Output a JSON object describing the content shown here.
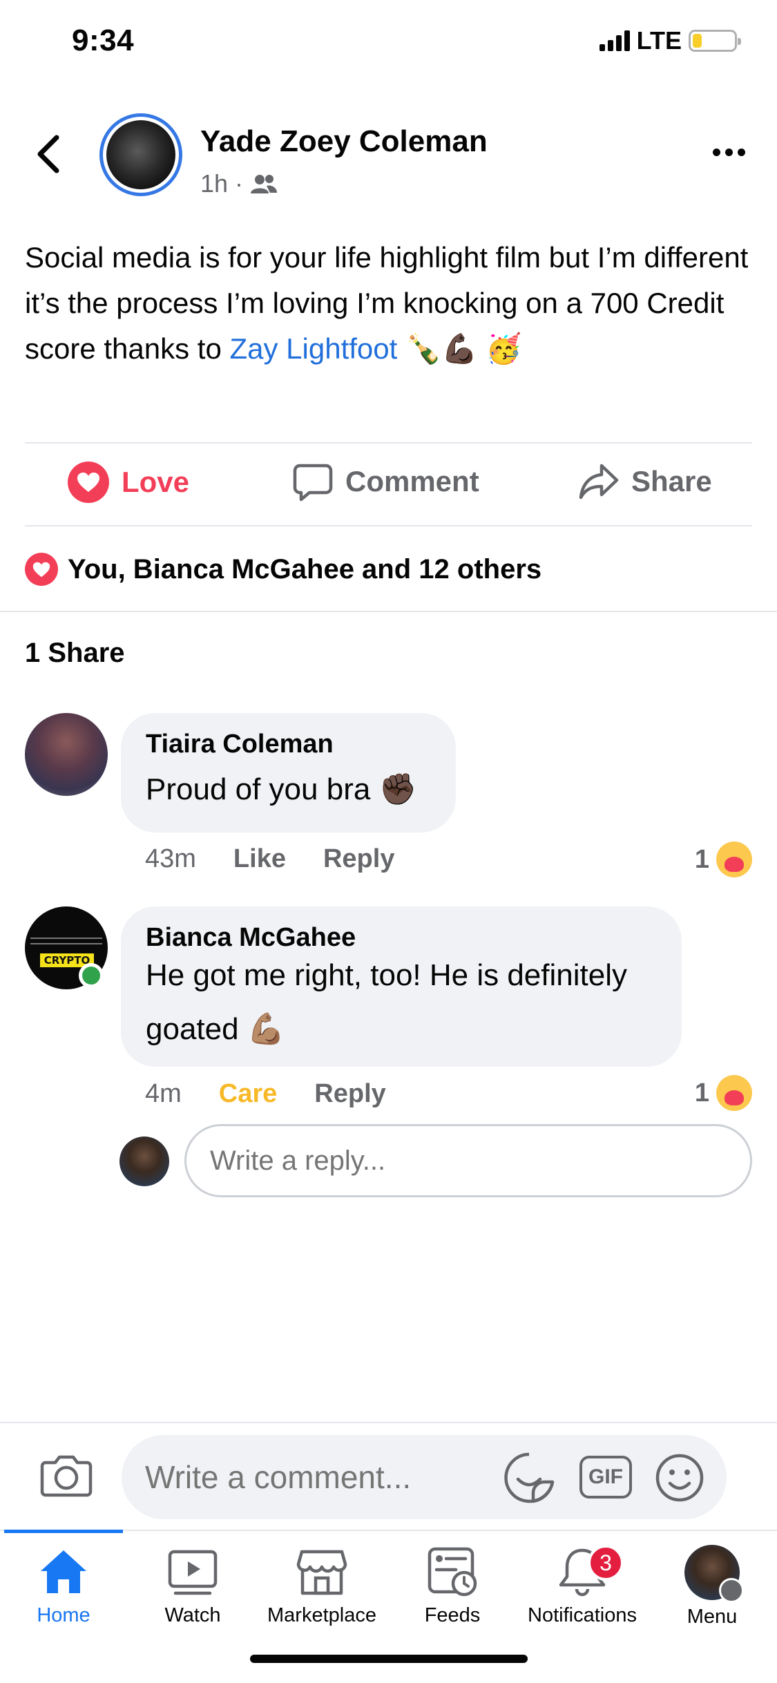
{
  "status_bar": {
    "time": "9:34",
    "network": "LTE",
    "battery_level": 0.22
  },
  "post": {
    "author": "Yade Zoey Coleman",
    "time": "1h",
    "privacy_icon": "friends-icon",
    "text_before": "Social media is for your life highlight film but I’m different it’s the process I’m loving I’m knocking on a 700 Credit score thanks to ",
    "mention": "Zay Lightfoot",
    "emojis": "🍾💪🏿 🥳",
    "actions": {
      "love": "Love",
      "comment": "Comment",
      "share": "Share"
    },
    "reactions_summary": "You, Bianca McGahee and 12 others",
    "shares": "1 Share"
  },
  "comments": [
    {
      "name": "Tiaira Coleman",
      "text": "Proud of you bra",
      "emoji": "✊🏿",
      "time": "43m",
      "like_label": "Like",
      "reply_label": "Reply",
      "reaction_count": "1"
    },
    {
      "name": "Bianca McGahee",
      "text": "He got me right, too! He is definitely goated",
      "emoji": "💪🏽",
      "time": "4m",
      "like_label": "Care",
      "reply_label": "Reply",
      "reaction_count": "1",
      "avatar_text": "CRYPTO"
    }
  ],
  "reply_box": {
    "placeholder": "Write a reply..."
  },
  "composer": {
    "placeholder": "Write a comment...",
    "gif_label": "GIF"
  },
  "tabs": [
    {
      "label": "Home",
      "icon": "home-icon",
      "active": true
    },
    {
      "label": "Watch",
      "icon": "watch-icon"
    },
    {
      "label": "Marketplace",
      "icon": "marketplace-icon"
    },
    {
      "label": "Feeds",
      "icon": "feeds-icon"
    },
    {
      "label": "Notifications",
      "icon": "bell-icon",
      "badge": "3"
    },
    {
      "label": "Menu",
      "icon": "menu-avatar"
    }
  ],
  "colors": {
    "accent": "#1877f2",
    "love": "#f33e58",
    "care": "#f7b928",
    "link": "#216fdb"
  }
}
